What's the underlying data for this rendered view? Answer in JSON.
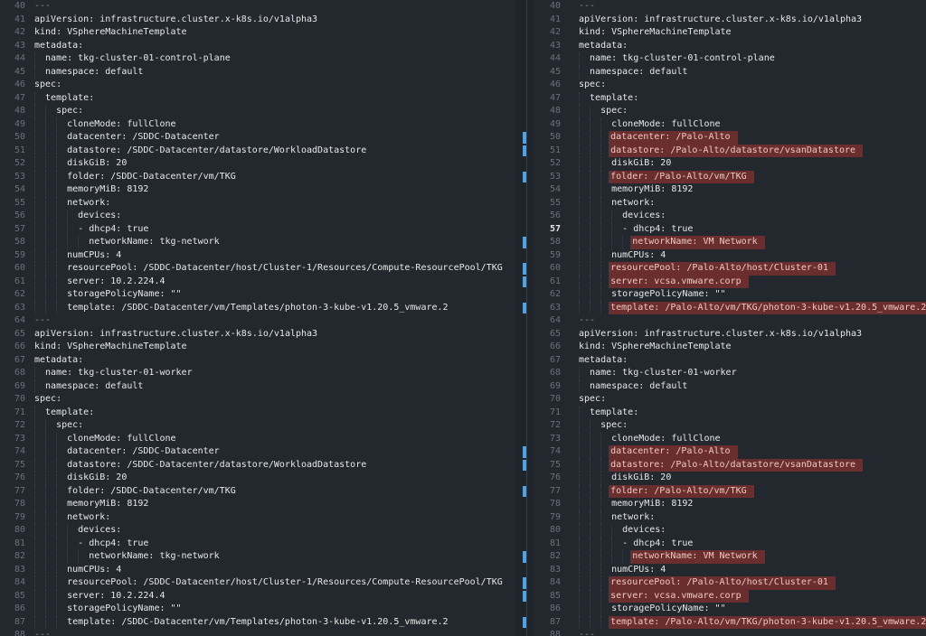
{
  "left": {
    "lines": [
      {
        "n": "40",
        "text": "---"
      },
      {
        "n": "41",
        "text": "apiVersion: infrastructure.cluster.x-k8s.io/v1alpha3"
      },
      {
        "n": "42",
        "text": "kind: VSphereMachineTemplate"
      },
      {
        "n": "43",
        "text": "metadata:"
      },
      {
        "n": "44",
        "text": "  name: tkg-cluster-01-control-plane"
      },
      {
        "n": "45",
        "text": "  namespace: default"
      },
      {
        "n": "46",
        "text": "spec:"
      },
      {
        "n": "47",
        "text": "  template:"
      },
      {
        "n": "48",
        "text": "    spec:"
      },
      {
        "n": "49",
        "text": "      cloneMode: fullClone"
      },
      {
        "n": "50",
        "text": "      datacenter: /SDDC-Datacenter"
      },
      {
        "n": "51",
        "text": "      datastore: /SDDC-Datacenter/datastore/WorkloadDatastore"
      },
      {
        "n": "52",
        "text": "      diskGiB: 20"
      },
      {
        "n": "53",
        "text": "      folder: /SDDC-Datacenter/vm/TKG"
      },
      {
        "n": "54",
        "text": "      memoryMiB: 8192"
      },
      {
        "n": "55",
        "text": "      network:"
      },
      {
        "n": "56",
        "text": "        devices:"
      },
      {
        "n": "57",
        "text": "        - dhcp4: true"
      },
      {
        "n": "58",
        "text": "          networkName: tkg-network"
      },
      {
        "n": "59",
        "text": "      numCPUs: 4"
      },
      {
        "n": "60",
        "text": "      resourcePool: /SDDC-Datacenter/host/Cluster-1/Resources/Compute-ResourcePool/TKG"
      },
      {
        "n": "61",
        "text": "      server: 10.2.224.4"
      },
      {
        "n": "62",
        "text": "      storagePolicyName: \"\""
      },
      {
        "n": "63",
        "text": "      template: /SDDC-Datacenter/vm/Templates/photon-3-kube-v1.20.5_vmware.2"
      },
      {
        "n": "64",
        "text": "---"
      },
      {
        "n": "65",
        "text": "apiVersion: infrastructure.cluster.x-k8s.io/v1alpha3"
      },
      {
        "n": "66",
        "text": "kind: VSphereMachineTemplate"
      },
      {
        "n": "67",
        "text": "metadata:"
      },
      {
        "n": "68",
        "text": "  name: tkg-cluster-01-worker"
      },
      {
        "n": "69",
        "text": "  namespace: default"
      },
      {
        "n": "70",
        "text": "spec:"
      },
      {
        "n": "71",
        "text": "  template:"
      },
      {
        "n": "72",
        "text": "    spec:"
      },
      {
        "n": "73",
        "text": "      cloneMode: fullClone"
      },
      {
        "n": "74",
        "text": "      datacenter: /SDDC-Datacenter"
      },
      {
        "n": "75",
        "text": "      datastore: /SDDC-Datacenter/datastore/WorkloadDatastore"
      },
      {
        "n": "76",
        "text": "      diskGiB: 20"
      },
      {
        "n": "77",
        "text": "      folder: /SDDC-Datacenter/vm/TKG"
      },
      {
        "n": "78",
        "text": "      memoryMiB: 8192"
      },
      {
        "n": "79",
        "text": "      network:"
      },
      {
        "n": "80",
        "text": "        devices:"
      },
      {
        "n": "81",
        "text": "        - dhcp4: true"
      },
      {
        "n": "82",
        "text": "          networkName: tkg-network"
      },
      {
        "n": "83",
        "text": "      numCPUs: 4"
      },
      {
        "n": "84",
        "text": "      resourcePool: /SDDC-Datacenter/host/Cluster-1/Resources/Compute-ResourcePool/TKG"
      },
      {
        "n": "85",
        "text": "      server: 10.2.224.4"
      },
      {
        "n": "86",
        "text": "      storagePolicyName: \"\""
      },
      {
        "n": "87",
        "text": "      template: /SDDC-Datacenter/vm/Templates/photon-3-kube-v1.20.5_vmware.2"
      },
      {
        "n": "88",
        "text": "---"
      }
    ]
  },
  "right": {
    "current_line": "57",
    "lines": [
      {
        "n": "40",
        "text": "---"
      },
      {
        "n": "41",
        "text": "apiVersion: infrastructure.cluster.x-k8s.io/v1alpha3"
      },
      {
        "n": "42",
        "text": "kind: VSphereMachineTemplate"
      },
      {
        "n": "43",
        "text": "metadata:"
      },
      {
        "n": "44",
        "text": "  name: tkg-cluster-01-control-plane"
      },
      {
        "n": "45",
        "text": "  namespace: default"
      },
      {
        "n": "46",
        "text": "spec:"
      },
      {
        "n": "47",
        "text": "  template:"
      },
      {
        "n": "48",
        "text": "    spec:"
      },
      {
        "n": "49",
        "text": "      cloneMode: fullClone"
      },
      {
        "n": "50",
        "text": "      datacenter: /Palo-Alto",
        "changed": true
      },
      {
        "n": "51",
        "text": "      datastore: /Palo-Alto/datastore/vsanDatastore",
        "changed": true
      },
      {
        "n": "52",
        "text": "      diskGiB: 20"
      },
      {
        "n": "53",
        "text": "      folder: /Palo-Alto/vm/TKG",
        "changed": true
      },
      {
        "n": "54",
        "text": "      memoryMiB: 8192"
      },
      {
        "n": "55",
        "text": "      network:"
      },
      {
        "n": "56",
        "text": "        devices:"
      },
      {
        "n": "57",
        "text": "        - dhcp4: true"
      },
      {
        "n": "58",
        "text": "          networkName: VM Network",
        "changed": true
      },
      {
        "n": "59",
        "text": "      numCPUs: 4"
      },
      {
        "n": "60",
        "text": "      resourcePool: /Palo-Alto/host/Cluster-01",
        "changed": true
      },
      {
        "n": "61",
        "text": "      server: vcsa.vmware.corp",
        "changed": true
      },
      {
        "n": "62",
        "text": "      storagePolicyName: \"\""
      },
      {
        "n": "63",
        "text": "      template: /Palo-Alto/vm/TKG/photon-3-kube-v1.20.5_vmware.2",
        "changed": true
      },
      {
        "n": "64",
        "text": "---"
      },
      {
        "n": "65",
        "text": "apiVersion: infrastructure.cluster.x-k8s.io/v1alpha3"
      },
      {
        "n": "66",
        "text": "kind: VSphereMachineTemplate"
      },
      {
        "n": "67",
        "text": "metadata:"
      },
      {
        "n": "68",
        "text": "  name: tkg-cluster-01-worker"
      },
      {
        "n": "69",
        "text": "  namespace: default"
      },
      {
        "n": "70",
        "text": "spec:"
      },
      {
        "n": "71",
        "text": "  template:"
      },
      {
        "n": "72",
        "text": "    spec:"
      },
      {
        "n": "73",
        "text": "      cloneMode: fullClone"
      },
      {
        "n": "74",
        "text": "      datacenter: /Palo-Alto",
        "changed": true
      },
      {
        "n": "75",
        "text": "      datastore: /Palo-Alto/datastore/vsanDatastore",
        "changed": true
      },
      {
        "n": "76",
        "text": "      diskGiB: 20"
      },
      {
        "n": "77",
        "text": "      folder: /Palo-Alto/vm/TKG",
        "changed": true
      },
      {
        "n": "78",
        "text": "      memoryMiB: 8192"
      },
      {
        "n": "79",
        "text": "      network:"
      },
      {
        "n": "80",
        "text": "        devices:"
      },
      {
        "n": "81",
        "text": "        - dhcp4: true"
      },
      {
        "n": "82",
        "text": "          networkName: VM Network",
        "changed": true
      },
      {
        "n": "83",
        "text": "      numCPUs: 4"
      },
      {
        "n": "84",
        "text": "      resourcePool: /Palo-Alto/host/Cluster-01",
        "changed": true
      },
      {
        "n": "85",
        "text": "      server: vcsa.vmware.corp",
        "changed": true
      },
      {
        "n": "86",
        "text": "      storagePolicyName: \"\""
      },
      {
        "n": "87",
        "text": "      template: /Palo-Alto/vm/TKG/photon-3-kube-v1.20.5_vmware.2",
        "changed": true
      },
      {
        "n": "88",
        "text": "---"
      }
    ]
  },
  "colors": {
    "background": "#23272e",
    "change_highlight": "#6b2e2f",
    "diff_marker": "#4ea3e6",
    "line_number": "#6b717b"
  }
}
